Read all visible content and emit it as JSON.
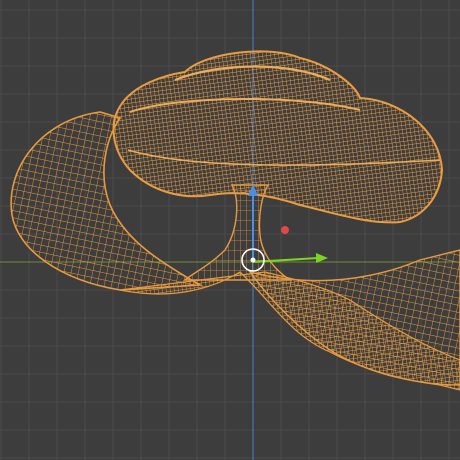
{
  "viewport": {
    "name": "3D Viewport",
    "background": "#3d3d3d",
    "grid_color": "#4a4a4a",
    "grid_major_color": "#555555",
    "axis_x_color": "#6e8b3d",
    "axis_z_color": "#4a78b0"
  },
  "object": {
    "display": "wireframe",
    "selected": true,
    "wire_color": "#f0a040",
    "wire_dark": "#b86f1e"
  },
  "gizmo": {
    "x_color": "#7ed321",
    "y_color": "#e0474a",
    "z_color": "#4a90e2",
    "pivot_color": "#ffffff"
  }
}
